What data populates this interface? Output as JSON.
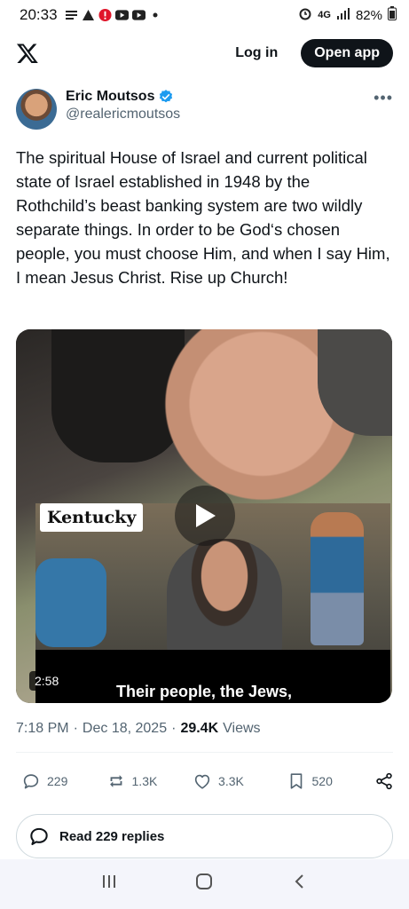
{
  "status_bar": {
    "time": "20:33",
    "network": "4G",
    "battery": "82%",
    "icons": [
      "news-icon",
      "warning-icon",
      "alert-badge-icon",
      "youtube-icon",
      "youtube-icon",
      "dot-icon"
    ]
  },
  "nav": {
    "login_label": "Log in",
    "open_app_label": "Open app"
  },
  "author": {
    "display_name": "Eric Moutsos",
    "handle": "@realericmoutsos",
    "verified": true
  },
  "tweet": {
    "text": "The spiritual House of Israel and current political state of Israel established in 1948 by the Rothchild’s beast banking system are two wildly separate things. In order to be God‘s chosen people, you must choose Him, and when I say Him, I mean Jesus Christ. Rise up Church!"
  },
  "media": {
    "overlay_label": "Kentucky",
    "duration": "2:58",
    "subtitle": "Their people, the Jews,"
  },
  "meta": {
    "time": "7:18 PM",
    "date": "Dec 18, 2025",
    "views_count": "29.4K",
    "views_label": "Views",
    "separator": "·"
  },
  "actions": {
    "replies": "229",
    "reposts": "1.3K",
    "likes": "3.3K",
    "bookmarks": "520"
  },
  "read_replies_label": "Read 229 replies",
  "colors": {
    "text_primary": "#0f1419",
    "text_secondary": "#536471",
    "verified_blue": "#1d9bf0",
    "button_dark": "#0f1419"
  }
}
